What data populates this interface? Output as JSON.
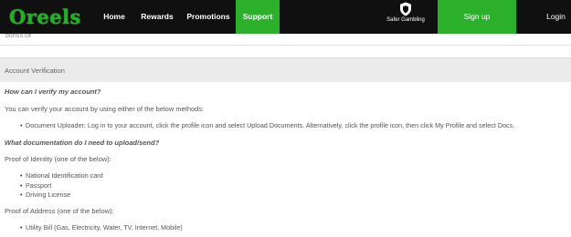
{
  "nav": {
    "logo": "Oreels",
    "home": "Home",
    "rewards": "Rewards",
    "promotions": "Promotions",
    "support": "Support",
    "safer_gambling": "Safer Gambling",
    "signup": "Sign up",
    "login": "Login",
    "accent": "#2cb02c"
  },
  "previous": {
    "text": "bonus ce"
  },
  "section": {
    "title": "Account Verification"
  },
  "content": {
    "q1": "How can I verify my account?",
    "p1": "You can verify your account by using either of the below methods:",
    "b1": "Document Uploader: Log in to your account, click the profile icon and select Upload Documents. Alternatively, click the profile icon, then click My Profile and select Docs.",
    "q2": "What documentation do I need to upload/send?",
    "identity_label": "Proof of Identity (one of the below):",
    "identity_items": [
      "National Identification card",
      "Passport",
      "Driving License"
    ],
    "address_label": "Proof of Address (one of the below):",
    "address_items": [
      "Utility Bill (Gas, Electricity, Water, TV, Internet, Mobile)"
    ]
  }
}
